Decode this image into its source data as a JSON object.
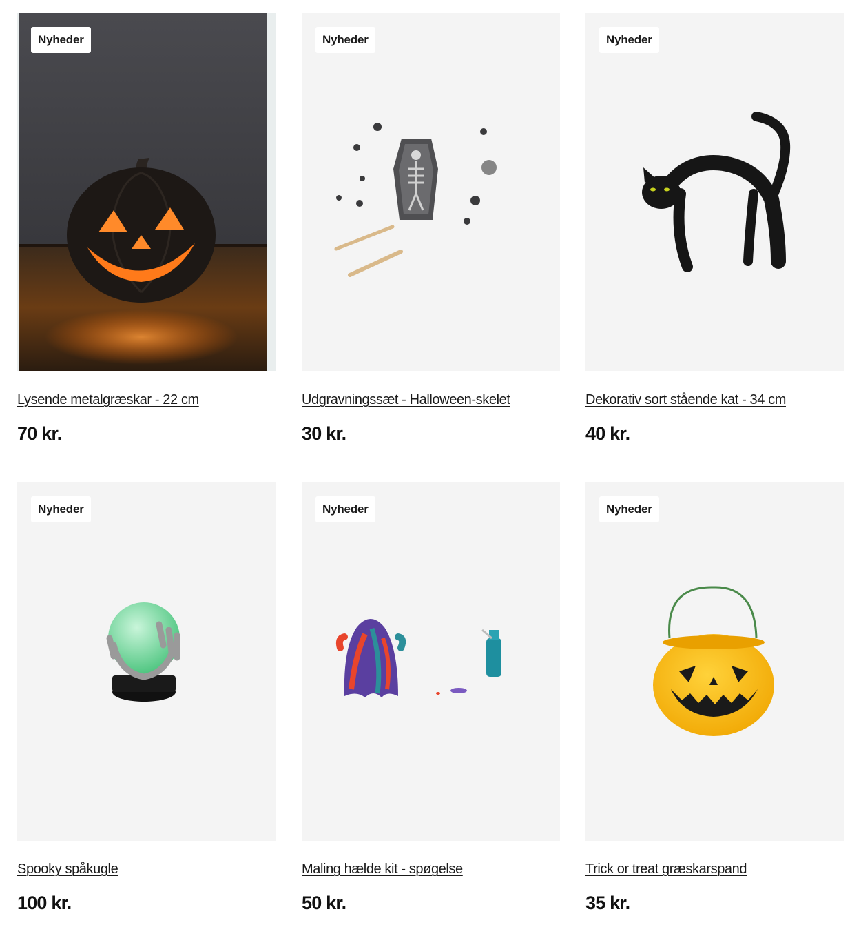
{
  "products": [
    {
      "badge": "Nyheder",
      "title": "Lysende metalgræskar - 22 cm",
      "price": "70 kr.",
      "icon": "jack-o-lantern-icon"
    },
    {
      "badge": "Nyheder",
      "title": "Udgravningssæt - Halloween-skelet",
      "price": "30 kr.",
      "icon": "skeleton-coffin-icon"
    },
    {
      "badge": "Nyheder",
      "title": "Dekorativ sort stående kat - 34 cm",
      "price": "40 kr.",
      "icon": "black-cat-icon"
    },
    {
      "badge": "Nyheder",
      "title": "Spooky spåkugle",
      "price": "100 kr.",
      "icon": "crystal-ball-icon"
    },
    {
      "badge": "Nyheder",
      "title": "Maling hælde kit - spøgelse",
      "price": "50 kr.",
      "icon": "painted-ghost-icon"
    },
    {
      "badge": "Nyheder",
      "title": "Trick or treat græskarspand",
      "price": "35 kr.",
      "icon": "pumpkin-bucket-icon"
    }
  ],
  "colors": {
    "image_background": "#f4f4f4",
    "pumpkin_glow": "#ff7a1a",
    "bucket_yellow": "#f6b800"
  }
}
